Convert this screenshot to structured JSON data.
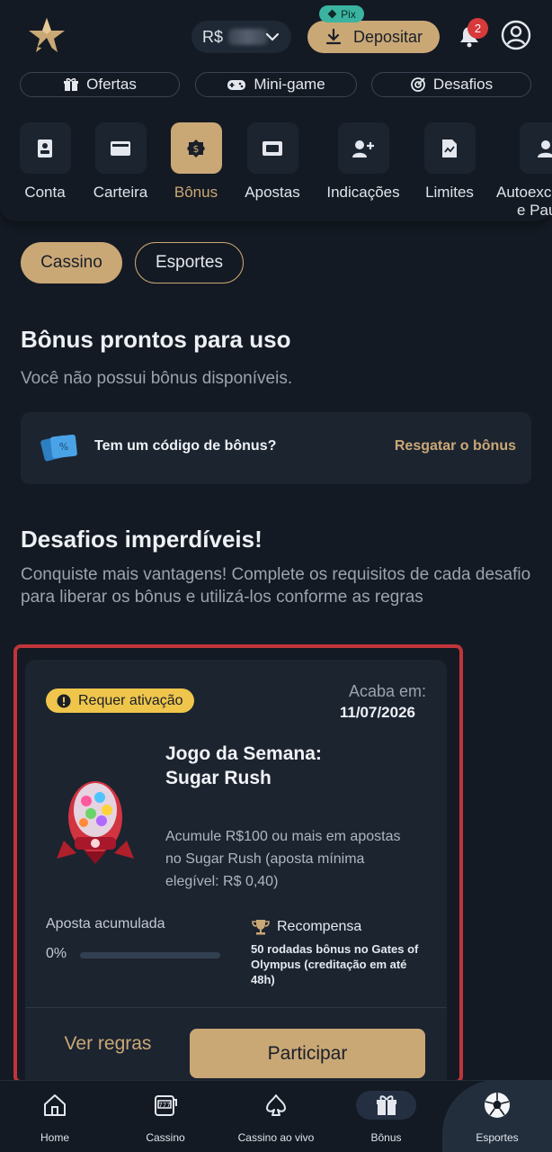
{
  "header": {
    "currency": "R$",
    "deposit_label": "Depositar",
    "pix_label": "Pix",
    "notifications_count": "2"
  },
  "quick_links": [
    {
      "label": "Ofertas",
      "icon": "gift-icon"
    },
    {
      "label": "Mini-game",
      "icon": "gamepad-icon"
    },
    {
      "label": "Desafios",
      "icon": "target-icon"
    }
  ],
  "account_menu": [
    {
      "label": "Conta",
      "icon": "id-card-icon"
    },
    {
      "label": "Carteira",
      "icon": "wallet-icon"
    },
    {
      "label": "Bônus",
      "icon": "bonus-coin-icon"
    },
    {
      "label": "Apostas",
      "icon": "ticket-icon"
    },
    {
      "label": "Indicações",
      "icon": "add-user-icon"
    },
    {
      "label": "Limites",
      "icon": "document-chart-icon"
    },
    {
      "label": "Autoexc",
      "label2": "e Pau",
      "icon": "user-icon"
    }
  ],
  "tabs": {
    "cassino": "Cassino",
    "esportes": "Esportes"
  },
  "ready_bonus": {
    "title": "Bônus prontos para uso",
    "empty_text": "Você não possui bônus disponíveis."
  },
  "bonus_code": {
    "question": "Tem um código de bônus?",
    "redeem_label": "Resgatar o bônus"
  },
  "challenges": {
    "title": "Desafios imperdíveis!",
    "description": "Conquiste mais vantagens! Complete os requisitos de cada desafio para liberar os bônus e utilizá-los conforme as regras"
  },
  "challenge_card": {
    "status_badge": "Requer ativação",
    "ends_label": "Acaba em:",
    "ends_date": "11/07/2026",
    "title": "Jogo da Semana: Sugar Rush",
    "description": "Acumule R$100 ou mais em apostas no Sugar Rush (aposta mínima elegível: R$ 0,40)",
    "accumulated_label": "Aposta acumulada",
    "progress_text": "0%",
    "progress_value": 0,
    "reward_label": "Recompensa",
    "reward_text": "50 rodadas bônus no Gates of Olympus (creditação em até 48h)",
    "rules_label": "Ver regras",
    "join_label": "Participar"
  },
  "bottom_nav": [
    {
      "label": "Home",
      "icon": "home-icon"
    },
    {
      "label": "Cassino",
      "icon": "slot-machine-icon"
    },
    {
      "label": "Cassino ao vivo",
      "icon": "spade-icon"
    },
    {
      "label": "Bônus",
      "icon": "gift-icon"
    },
    {
      "label": "Esportes",
      "icon": "soccer-ball-icon"
    }
  ],
  "colors": {
    "background": "#141a23",
    "card": "#1c2430",
    "accent_gold": "#caa876",
    "badge_yellow": "#efc64b",
    "notification_red": "#d8393a",
    "pix_teal": "#3ab4a0",
    "highlight_red": "#c0353a"
  }
}
